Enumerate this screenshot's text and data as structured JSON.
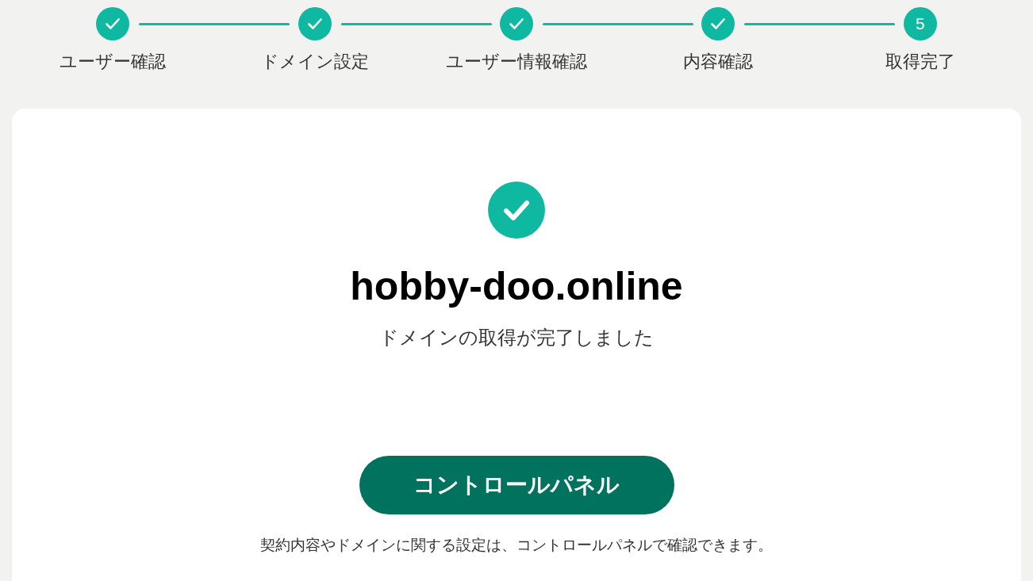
{
  "steps": [
    {
      "label": "ユーザー確認",
      "completed": true
    },
    {
      "label": "ドメイン設定",
      "completed": true
    },
    {
      "label": "ユーザー情報確認",
      "completed": true
    },
    {
      "label": "内容確認",
      "completed": true
    },
    {
      "label": "取得完了",
      "completed": false,
      "number": "5"
    }
  ],
  "result": {
    "domain": "hobby-doo.online",
    "message": "ドメインの取得が完了しました"
  },
  "control_panel_button": {
    "label": "コントロールパネル"
  },
  "note": "契約内容やドメインに関する設定は、コントロールパネルで確認できます。"
}
